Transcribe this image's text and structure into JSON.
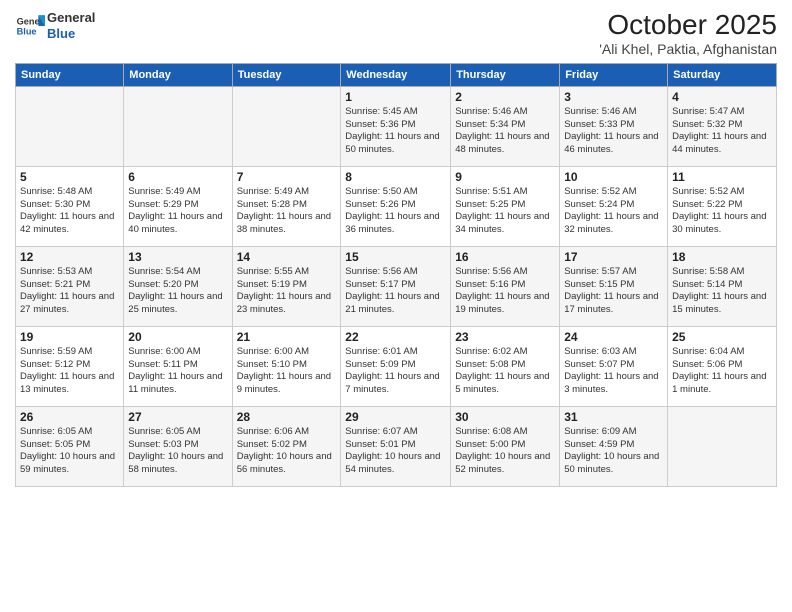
{
  "header": {
    "logo_line1": "General",
    "logo_line2": "Blue",
    "month": "October 2025",
    "location": "'Ali Khel, Paktia, Afghanistan"
  },
  "weekdays": [
    "Sunday",
    "Monday",
    "Tuesday",
    "Wednesday",
    "Thursday",
    "Friday",
    "Saturday"
  ],
  "weeks": [
    [
      {
        "day": "",
        "info": ""
      },
      {
        "day": "",
        "info": ""
      },
      {
        "day": "",
        "info": ""
      },
      {
        "day": "1",
        "info": "Sunrise: 5:45 AM\nSunset: 5:36 PM\nDaylight: 11 hours and 50 minutes."
      },
      {
        "day": "2",
        "info": "Sunrise: 5:46 AM\nSunset: 5:34 PM\nDaylight: 11 hours and 48 minutes."
      },
      {
        "day": "3",
        "info": "Sunrise: 5:46 AM\nSunset: 5:33 PM\nDaylight: 11 hours and 46 minutes."
      },
      {
        "day": "4",
        "info": "Sunrise: 5:47 AM\nSunset: 5:32 PM\nDaylight: 11 hours and 44 minutes."
      }
    ],
    [
      {
        "day": "5",
        "info": "Sunrise: 5:48 AM\nSunset: 5:30 PM\nDaylight: 11 hours and 42 minutes."
      },
      {
        "day": "6",
        "info": "Sunrise: 5:49 AM\nSunset: 5:29 PM\nDaylight: 11 hours and 40 minutes."
      },
      {
        "day": "7",
        "info": "Sunrise: 5:49 AM\nSunset: 5:28 PM\nDaylight: 11 hours and 38 minutes."
      },
      {
        "day": "8",
        "info": "Sunrise: 5:50 AM\nSunset: 5:26 PM\nDaylight: 11 hours and 36 minutes."
      },
      {
        "day": "9",
        "info": "Sunrise: 5:51 AM\nSunset: 5:25 PM\nDaylight: 11 hours and 34 minutes."
      },
      {
        "day": "10",
        "info": "Sunrise: 5:52 AM\nSunset: 5:24 PM\nDaylight: 11 hours and 32 minutes."
      },
      {
        "day": "11",
        "info": "Sunrise: 5:52 AM\nSunset: 5:22 PM\nDaylight: 11 hours and 30 minutes."
      }
    ],
    [
      {
        "day": "12",
        "info": "Sunrise: 5:53 AM\nSunset: 5:21 PM\nDaylight: 11 hours and 27 minutes."
      },
      {
        "day": "13",
        "info": "Sunrise: 5:54 AM\nSunset: 5:20 PM\nDaylight: 11 hours and 25 minutes."
      },
      {
        "day": "14",
        "info": "Sunrise: 5:55 AM\nSunset: 5:19 PM\nDaylight: 11 hours and 23 minutes."
      },
      {
        "day": "15",
        "info": "Sunrise: 5:56 AM\nSunset: 5:17 PM\nDaylight: 11 hours and 21 minutes."
      },
      {
        "day": "16",
        "info": "Sunrise: 5:56 AM\nSunset: 5:16 PM\nDaylight: 11 hours and 19 minutes."
      },
      {
        "day": "17",
        "info": "Sunrise: 5:57 AM\nSunset: 5:15 PM\nDaylight: 11 hours and 17 minutes."
      },
      {
        "day": "18",
        "info": "Sunrise: 5:58 AM\nSunset: 5:14 PM\nDaylight: 11 hours and 15 minutes."
      }
    ],
    [
      {
        "day": "19",
        "info": "Sunrise: 5:59 AM\nSunset: 5:12 PM\nDaylight: 11 hours and 13 minutes."
      },
      {
        "day": "20",
        "info": "Sunrise: 6:00 AM\nSunset: 5:11 PM\nDaylight: 11 hours and 11 minutes."
      },
      {
        "day": "21",
        "info": "Sunrise: 6:00 AM\nSunset: 5:10 PM\nDaylight: 11 hours and 9 minutes."
      },
      {
        "day": "22",
        "info": "Sunrise: 6:01 AM\nSunset: 5:09 PM\nDaylight: 11 hours and 7 minutes."
      },
      {
        "day": "23",
        "info": "Sunrise: 6:02 AM\nSunset: 5:08 PM\nDaylight: 11 hours and 5 minutes."
      },
      {
        "day": "24",
        "info": "Sunrise: 6:03 AM\nSunset: 5:07 PM\nDaylight: 11 hours and 3 minutes."
      },
      {
        "day": "25",
        "info": "Sunrise: 6:04 AM\nSunset: 5:06 PM\nDaylight: 11 hours and 1 minute."
      }
    ],
    [
      {
        "day": "26",
        "info": "Sunrise: 6:05 AM\nSunset: 5:05 PM\nDaylight: 10 hours and 59 minutes."
      },
      {
        "day": "27",
        "info": "Sunrise: 6:05 AM\nSunset: 5:03 PM\nDaylight: 10 hours and 58 minutes."
      },
      {
        "day": "28",
        "info": "Sunrise: 6:06 AM\nSunset: 5:02 PM\nDaylight: 10 hours and 56 minutes."
      },
      {
        "day": "29",
        "info": "Sunrise: 6:07 AM\nSunset: 5:01 PM\nDaylight: 10 hours and 54 minutes."
      },
      {
        "day": "30",
        "info": "Sunrise: 6:08 AM\nSunset: 5:00 PM\nDaylight: 10 hours and 52 minutes."
      },
      {
        "day": "31",
        "info": "Sunrise: 6:09 AM\nSunset: 4:59 PM\nDaylight: 10 hours and 50 minutes."
      },
      {
        "day": "",
        "info": ""
      }
    ]
  ]
}
